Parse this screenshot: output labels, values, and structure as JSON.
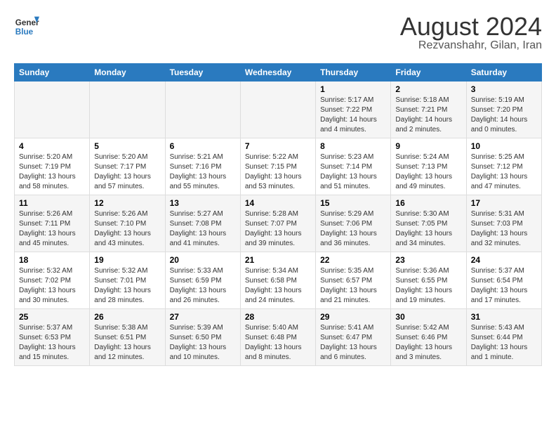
{
  "header": {
    "logo_line1": "General",
    "logo_line2": "Blue",
    "title": "August 2024",
    "subtitle": "Rezvanshahr, Gilan, Iran"
  },
  "calendar": {
    "weekdays": [
      "Sunday",
      "Monday",
      "Tuesday",
      "Wednesday",
      "Thursday",
      "Friday",
      "Saturday"
    ],
    "weeks": [
      [
        {
          "day": "",
          "info": ""
        },
        {
          "day": "",
          "info": ""
        },
        {
          "day": "",
          "info": ""
        },
        {
          "day": "",
          "info": ""
        },
        {
          "day": "1",
          "info": "Sunrise: 5:17 AM\nSunset: 7:22 PM\nDaylight: 14 hours\nand 4 minutes."
        },
        {
          "day": "2",
          "info": "Sunrise: 5:18 AM\nSunset: 7:21 PM\nDaylight: 14 hours\nand 2 minutes."
        },
        {
          "day": "3",
          "info": "Sunrise: 5:19 AM\nSunset: 7:20 PM\nDaylight: 14 hours\nand 0 minutes."
        }
      ],
      [
        {
          "day": "4",
          "info": "Sunrise: 5:20 AM\nSunset: 7:19 PM\nDaylight: 13 hours\nand 58 minutes."
        },
        {
          "day": "5",
          "info": "Sunrise: 5:20 AM\nSunset: 7:17 PM\nDaylight: 13 hours\nand 57 minutes."
        },
        {
          "day": "6",
          "info": "Sunrise: 5:21 AM\nSunset: 7:16 PM\nDaylight: 13 hours\nand 55 minutes."
        },
        {
          "day": "7",
          "info": "Sunrise: 5:22 AM\nSunset: 7:15 PM\nDaylight: 13 hours\nand 53 minutes."
        },
        {
          "day": "8",
          "info": "Sunrise: 5:23 AM\nSunset: 7:14 PM\nDaylight: 13 hours\nand 51 minutes."
        },
        {
          "day": "9",
          "info": "Sunrise: 5:24 AM\nSunset: 7:13 PM\nDaylight: 13 hours\nand 49 minutes."
        },
        {
          "day": "10",
          "info": "Sunrise: 5:25 AM\nSunset: 7:12 PM\nDaylight: 13 hours\nand 47 minutes."
        }
      ],
      [
        {
          "day": "11",
          "info": "Sunrise: 5:26 AM\nSunset: 7:11 PM\nDaylight: 13 hours\nand 45 minutes."
        },
        {
          "day": "12",
          "info": "Sunrise: 5:26 AM\nSunset: 7:10 PM\nDaylight: 13 hours\nand 43 minutes."
        },
        {
          "day": "13",
          "info": "Sunrise: 5:27 AM\nSunset: 7:08 PM\nDaylight: 13 hours\nand 41 minutes."
        },
        {
          "day": "14",
          "info": "Sunrise: 5:28 AM\nSunset: 7:07 PM\nDaylight: 13 hours\nand 39 minutes."
        },
        {
          "day": "15",
          "info": "Sunrise: 5:29 AM\nSunset: 7:06 PM\nDaylight: 13 hours\nand 36 minutes."
        },
        {
          "day": "16",
          "info": "Sunrise: 5:30 AM\nSunset: 7:05 PM\nDaylight: 13 hours\nand 34 minutes."
        },
        {
          "day": "17",
          "info": "Sunrise: 5:31 AM\nSunset: 7:03 PM\nDaylight: 13 hours\nand 32 minutes."
        }
      ],
      [
        {
          "day": "18",
          "info": "Sunrise: 5:32 AM\nSunset: 7:02 PM\nDaylight: 13 hours\nand 30 minutes."
        },
        {
          "day": "19",
          "info": "Sunrise: 5:32 AM\nSunset: 7:01 PM\nDaylight: 13 hours\nand 28 minutes."
        },
        {
          "day": "20",
          "info": "Sunrise: 5:33 AM\nSunset: 6:59 PM\nDaylight: 13 hours\nand 26 minutes."
        },
        {
          "day": "21",
          "info": "Sunrise: 5:34 AM\nSunset: 6:58 PM\nDaylight: 13 hours\nand 24 minutes."
        },
        {
          "day": "22",
          "info": "Sunrise: 5:35 AM\nSunset: 6:57 PM\nDaylight: 13 hours\nand 21 minutes."
        },
        {
          "day": "23",
          "info": "Sunrise: 5:36 AM\nSunset: 6:55 PM\nDaylight: 13 hours\nand 19 minutes."
        },
        {
          "day": "24",
          "info": "Sunrise: 5:37 AM\nSunset: 6:54 PM\nDaylight: 13 hours\nand 17 minutes."
        }
      ],
      [
        {
          "day": "25",
          "info": "Sunrise: 5:37 AM\nSunset: 6:53 PM\nDaylight: 13 hours\nand 15 minutes."
        },
        {
          "day": "26",
          "info": "Sunrise: 5:38 AM\nSunset: 6:51 PM\nDaylight: 13 hours\nand 12 minutes."
        },
        {
          "day": "27",
          "info": "Sunrise: 5:39 AM\nSunset: 6:50 PM\nDaylight: 13 hours\nand 10 minutes."
        },
        {
          "day": "28",
          "info": "Sunrise: 5:40 AM\nSunset: 6:48 PM\nDaylight: 13 hours\nand 8 minutes."
        },
        {
          "day": "29",
          "info": "Sunrise: 5:41 AM\nSunset: 6:47 PM\nDaylight: 13 hours\nand 6 minutes."
        },
        {
          "day": "30",
          "info": "Sunrise: 5:42 AM\nSunset: 6:46 PM\nDaylight: 13 hours\nand 3 minutes."
        },
        {
          "day": "31",
          "info": "Sunrise: 5:43 AM\nSunset: 6:44 PM\nDaylight: 13 hours\nand 1 minute."
        }
      ]
    ]
  }
}
